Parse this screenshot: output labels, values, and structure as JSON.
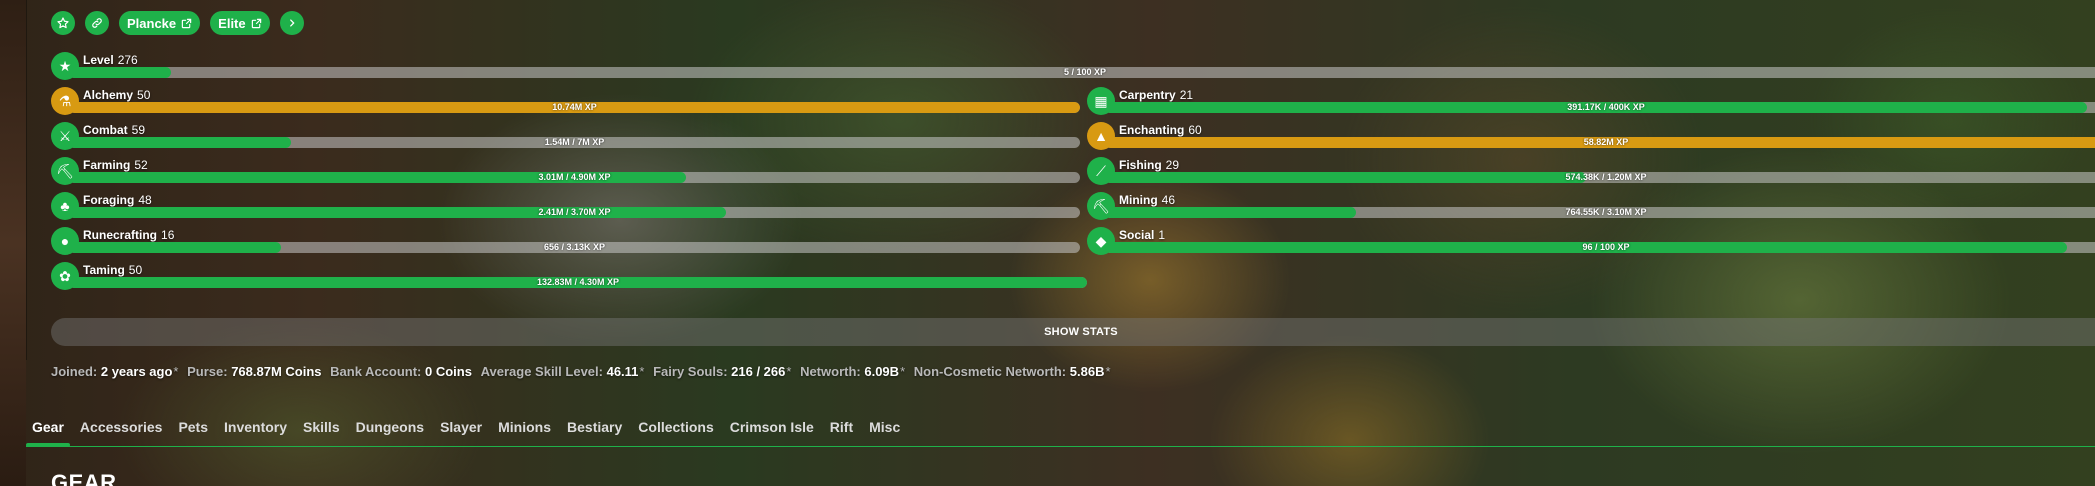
{
  "header": {
    "buttons": [
      {
        "icon": "star-icon"
      },
      {
        "icon": "link-icon"
      },
      {
        "label": "Plancke",
        "icon": "external-link-icon"
      },
      {
        "label": "Elite",
        "icon": "external-link-icon"
      },
      {
        "icon": "chevron-right-icon"
      }
    ]
  },
  "level": {
    "name": "Level",
    "value": "276",
    "progress_text": "5 / 100 XP",
    "progress": 0.05
  },
  "skills": {
    "alchemy": {
      "name": "Alchemy",
      "value": "50",
      "progress_text": "10.74M XP",
      "progress": 1.0,
      "color": "#d89a12"
    },
    "carpentry": {
      "name": "Carpentry",
      "value": "21",
      "progress_text": "391.17K / 400K XP",
      "progress": 0.98
    },
    "combat": {
      "name": "Combat",
      "value": "59",
      "progress_text": "1.54M / 7M XP",
      "progress": 0.22
    },
    "enchanting": {
      "name": "Enchanting",
      "value": "60",
      "progress_text": "58.82M XP",
      "progress": 1.0,
      "color": "#d89a12"
    },
    "farming": {
      "name": "Farming",
      "value": "52",
      "progress_text": "3.01M / 4.90M XP",
      "progress": 0.61
    },
    "fishing": {
      "name": "Fishing",
      "value": "29",
      "progress_text": "574.38K / 1.20M XP",
      "progress": 0.48
    },
    "foraging": {
      "name": "Foraging",
      "value": "48",
      "progress_text": "2.41M / 3.70M XP",
      "progress": 0.65
    },
    "mining": {
      "name": "Mining",
      "value": "46",
      "progress_text": "764.55K / 3.10M XP",
      "progress": 0.25
    },
    "runecrafting": {
      "name": "Runecrafting",
      "value": "16",
      "progress_text": "656 / 3.13K XP",
      "progress": 0.21
    },
    "social": {
      "name": "Social",
      "value": "1",
      "progress_text": "96 / 100 XP",
      "progress": 0.96
    },
    "taming": {
      "name": "Taming",
      "value": "50",
      "progress_text": "132.83M / 4.30M XP",
      "progress": 1.0
    }
  },
  "show_stats_label": "SHOW STATS",
  "stats": {
    "joined_label": "Joined:",
    "joined_value": "2 years ago",
    "purse_label": "Purse:",
    "purse_value": "768.87M Coins",
    "bank_label": "Bank Account:",
    "bank_value": "0 Coins",
    "avg_skill_label": "Average Skill Level:",
    "avg_skill_value": "46.11",
    "fairy_label": "Fairy Souls:",
    "fairy_value": "216 / 266",
    "networth_label": "Networth:",
    "networth_value": "6.09B",
    "noncos_label": "Non-Cosmetic Networth:",
    "noncos_value": "5.86B",
    "asterisk": "*"
  },
  "tabs": [
    "Gear",
    "Accessories",
    "Pets",
    "Inventory",
    "Skills",
    "Dungeons",
    "Slayer",
    "Minions",
    "Bestiary",
    "Collections",
    "Crimson Isle",
    "Rift",
    "Misc"
  ],
  "active_tab": "Gear",
  "section_title": "GEAR",
  "colors": {
    "accent": "#1fb14a",
    "maxed": "#d89a12"
  }
}
